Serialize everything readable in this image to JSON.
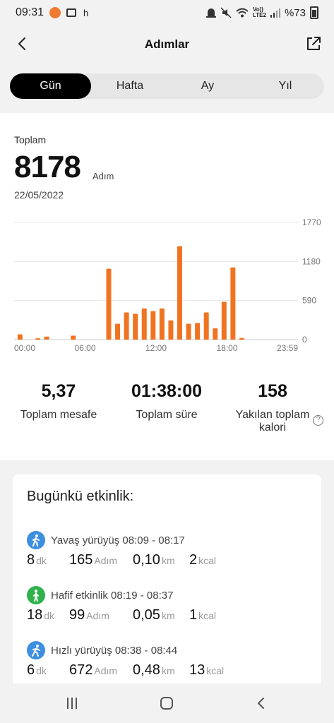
{
  "status_bar": {
    "time": "09:31",
    "h_label": "h",
    "volte": "Vo))\nLTE2",
    "battery": "%73"
  },
  "header": {
    "title": "Adımlar"
  },
  "tabs": [
    {
      "label": "Gün",
      "active": true
    },
    {
      "label": "Hafta",
      "active": false
    },
    {
      "label": "Ay",
      "active": false
    },
    {
      "label": "Yıl",
      "active": false
    }
  ],
  "summary": {
    "total_label": "Toplam",
    "total_value": "8178",
    "total_unit": "Adım",
    "date": "22/05/2022"
  },
  "chart_data": {
    "type": "bar",
    "y_ticks": [
      "1770",
      "1180",
      "590",
      "0"
    ],
    "ylim": [
      0,
      1770
    ],
    "x_ticks": [
      "00:00",
      "06:00",
      "12:00",
      "18:00",
      "23:59"
    ],
    "bar_color": "#f07321",
    "bars": [
      {
        "hour": 0.5,
        "value": 80
      },
      {
        "hour": 2.0,
        "value": 20
      },
      {
        "hour": 2.75,
        "value": 45
      },
      {
        "hour": 5.0,
        "value": 60
      },
      {
        "hour": 8.0,
        "value": 1070
      },
      {
        "hour": 8.75,
        "value": 240
      },
      {
        "hour": 9.5,
        "value": 410
      },
      {
        "hour": 10.25,
        "value": 390
      },
      {
        "hour": 11.0,
        "value": 470
      },
      {
        "hour": 11.75,
        "value": 430
      },
      {
        "hour": 12.5,
        "value": 470
      },
      {
        "hour": 13.25,
        "value": 290
      },
      {
        "hour": 14.0,
        "value": 1410
      },
      {
        "hour": 14.75,
        "value": 240
      },
      {
        "hour": 15.5,
        "value": 250
      },
      {
        "hour": 16.25,
        "value": 410
      },
      {
        "hour": 17.0,
        "value": 170
      },
      {
        "hour": 17.75,
        "value": 570
      },
      {
        "hour": 18.5,
        "value": 1090
      },
      {
        "hour": 19.25,
        "value": 25
      }
    ]
  },
  "stats": {
    "distance": {
      "value": "5,37",
      "label": "Toplam mesafe"
    },
    "duration": {
      "value": "01:38:00",
      "label": "Toplam süre"
    },
    "calories": {
      "value": "158",
      "label": "Yakılan toplam kalori"
    }
  },
  "activity": {
    "title": "Bugünkü etkinlik:",
    "items": [
      {
        "icon": "walk-icon",
        "color": "#3d8fe0",
        "name": "Yavaş yürüyüş 08:09 - 08:17",
        "min": "8",
        "min_unit": "dk",
        "steps": "165",
        "steps_unit": "Adım",
        "km": "0,10",
        "km_unit": "km",
        "kcal": "2",
        "kcal_unit": "kcal"
      },
      {
        "icon": "activity-icon",
        "color": "#2fb24c",
        "name": "Hafif etkinlik 08:19 - 08:37",
        "min": "18",
        "min_unit": "dk",
        "steps": "99",
        "steps_unit": "Adım",
        "km": "0,05",
        "km_unit": "km",
        "kcal": "1",
        "kcal_unit": "kcal"
      },
      {
        "icon": "fast-walk-icon",
        "color": "#3d8fe0",
        "name": "Hızlı yürüyüş 08:38 - 08:44",
        "min": "6",
        "min_unit": "dk",
        "steps": "672",
        "steps_unit": "Adım",
        "km": "0,48",
        "km_unit": "km",
        "kcal": "13",
        "kcal_unit": "kcal"
      }
    ]
  }
}
